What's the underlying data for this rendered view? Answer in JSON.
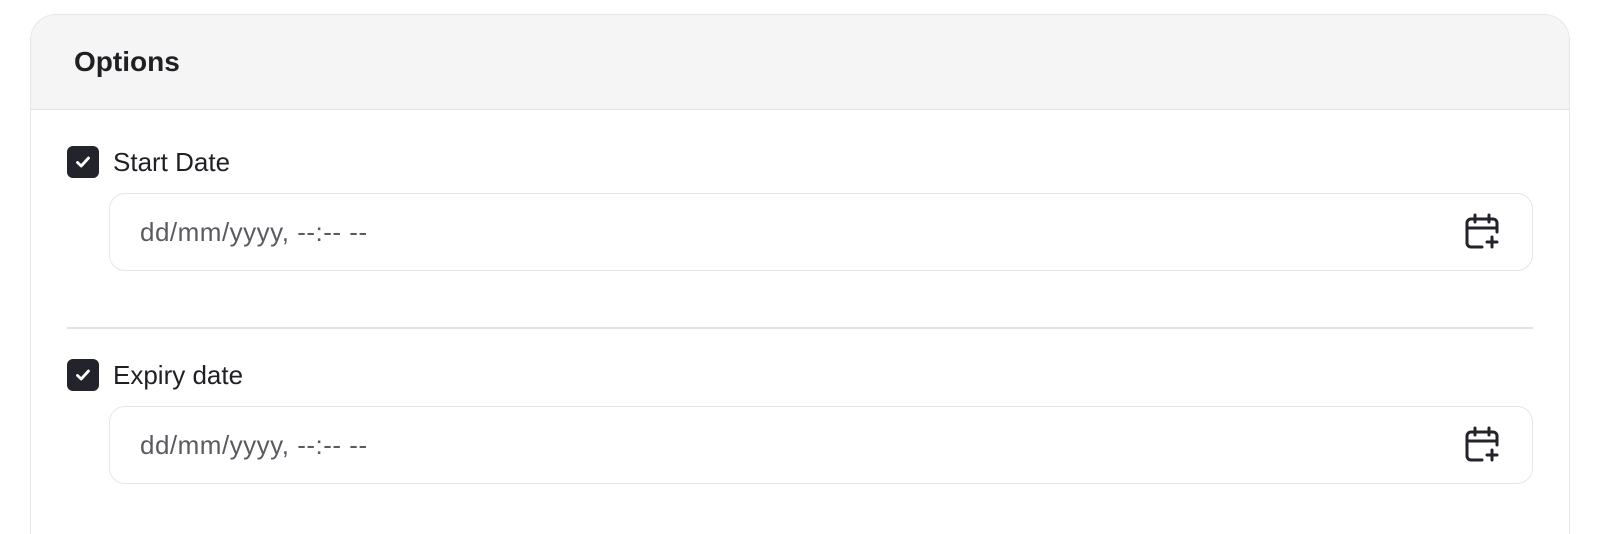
{
  "card": {
    "title": "Options"
  },
  "options": [
    {
      "label": "Start Date",
      "checked": true,
      "input_placeholder": "dd/mm/yyyy, --:-- --",
      "icon": "calendar-plus-icon"
    },
    {
      "label": "Expiry date",
      "checked": true,
      "input_placeholder": "dd/mm/yyyy, --:-- --",
      "icon": "calendar-plus-icon"
    }
  ],
  "colors": {
    "checkbox_fill": "#23232b",
    "header_bg": "#f5f5f5",
    "border": "#e6e6e6"
  }
}
